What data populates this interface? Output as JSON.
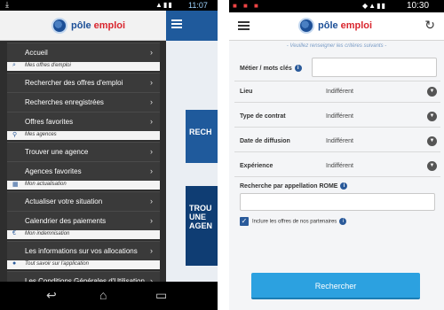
{
  "left_phone": {
    "status_time": "11:07",
    "brand": {
      "part1": "pôle",
      "part2": "emploi"
    },
    "menu": [
      {
        "type": "item",
        "label": "Accueil"
      },
      {
        "type": "section",
        "label": "Mes offres d'emploi",
        "icon": "search-icon"
      },
      {
        "type": "item",
        "label": "Rechercher des offres d'emploi"
      },
      {
        "type": "item",
        "label": "Recherches enregistrées"
      },
      {
        "type": "item",
        "label": "Offres favorites"
      },
      {
        "type": "section",
        "label": "Mes agences",
        "icon": "pin-icon"
      },
      {
        "type": "item",
        "label": "Trouver une agence"
      },
      {
        "type": "item",
        "label": "Agences favorites"
      },
      {
        "type": "section",
        "label": "Mon actualisation",
        "icon": "calendar-icon"
      },
      {
        "type": "item",
        "label": "Actualiser votre situation"
      },
      {
        "type": "item",
        "label": "Calendrier des paiements"
      },
      {
        "type": "section",
        "label": "Mon indemnisation",
        "icon": "euro-icon"
      },
      {
        "type": "item",
        "label": "Les informations sur vos allocations"
      },
      {
        "type": "section",
        "label": "Tout savoir sur l'application",
        "icon": "info-icon"
      },
      {
        "type": "item",
        "label": "Les Conditions Générales d'Utilisation"
      }
    ],
    "peek": {
      "banner1": "RECH",
      "banner2_l1": "TROU",
      "banner2_l2": "UNE",
      "banner2_l3": "AGEN"
    }
  },
  "right_phone": {
    "status_time": "10:30",
    "brand": {
      "part1": "pôle",
      "part2": "emploi"
    },
    "hint": "- Veuillez renseigner les critères suivants -",
    "fields": {
      "metier_label": "Métier / mots clés",
      "lieu_label": "Lieu",
      "lieu_value": "Indifférent",
      "contrat_label": "Type de contrat",
      "contrat_value": "Indifférent",
      "diffusion_label": "Date de diffusion",
      "diffusion_value": "Indifférent",
      "experience_label": "Expérience",
      "experience_value": "Indifférent",
      "rome_label": "Recherche par appellation ROME"
    },
    "partners_checkbox": {
      "label": "Inclure les offres de nos partenaires",
      "checked": true
    },
    "search_button": "Rechercher"
  },
  "colors": {
    "brand_blue": "#1c4f97",
    "brand_red": "#d9262e",
    "button_blue": "#2ca1e0",
    "drawer_dark": "#2e2e2e"
  }
}
